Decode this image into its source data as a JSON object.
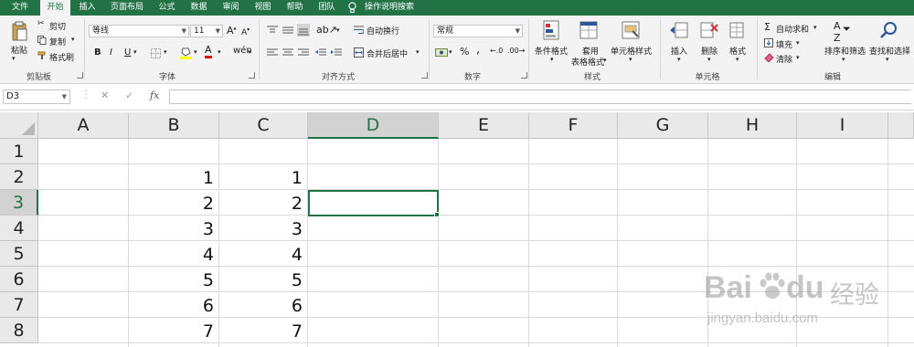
{
  "menu": {
    "tabs": [
      "文件",
      "开始",
      "插入",
      "页面布局",
      "公式",
      "数据",
      "审阅",
      "视图",
      "帮助",
      "团队"
    ],
    "active_tab": "开始",
    "search_label": "操作说明搜索"
  },
  "ribbon": {
    "clipboard": {
      "paste": "粘贴",
      "cut": "剪切",
      "copy": "复制",
      "format_painter": "格式刷",
      "label": "剪贴板"
    },
    "font": {
      "font_name": "等线",
      "font_size": "11",
      "bold": "B",
      "italic": "I",
      "underline": "U",
      "grow": "A",
      "shrink": "A",
      "label": "字体"
    },
    "alignment": {
      "wrap_text": "自动换行",
      "merge_center": "合并后居中",
      "label": "对齐方式"
    },
    "number": {
      "format": "常规",
      "percent": "%",
      "comma": ",",
      "label": "数字"
    },
    "styles": {
      "conditional": "条件格式",
      "table_format_1": "套用",
      "table_format_2": "表格格式",
      "cell_styles": "单元格样式",
      "label": "样式"
    },
    "cells": {
      "insert": "插入",
      "delete": "删除",
      "format": "格式",
      "label": "单元格"
    },
    "editing": {
      "autosum": "自动求和",
      "fill": "填充",
      "clear": "清除",
      "sort_filter": "排序和筛选",
      "find_select": "查找和选择",
      "label": "编辑"
    }
  },
  "formula_bar": {
    "name_box": "D3",
    "fx": "fx",
    "cancel": "✕",
    "enter": "✓",
    "value": ""
  },
  "sheet": {
    "columns": [
      "A",
      "B",
      "C",
      "D",
      "E",
      "F",
      "G",
      "H",
      "I"
    ],
    "rows": [
      "1",
      "2",
      "3",
      "4",
      "5",
      "6",
      "7",
      "8"
    ],
    "selected_column": "D",
    "selected_row": "3",
    "col_b": [
      "",
      "1",
      "2",
      "3",
      "4",
      "5",
      "6",
      "7"
    ],
    "col_c": [
      "",
      "1",
      "2",
      "3",
      "4",
      "5",
      "6",
      "7"
    ]
  },
  "watermark": {
    "brand": "Bai",
    "brand2": "du",
    "cn": "经验",
    "url": "jingyan.baidu.com"
  },
  "colors": {
    "accent": "#217346",
    "header_bg": "#e9e9e9",
    "grid": "#dadada"
  }
}
